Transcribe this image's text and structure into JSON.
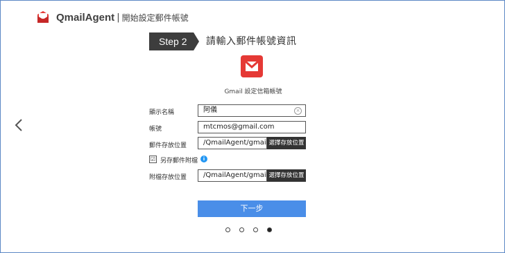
{
  "header": {
    "app_name": "QmailAgent",
    "separator": "|",
    "subtitle": "開始設定郵件帳號"
  },
  "step": {
    "label": "Step 2",
    "title": "請輸入郵件帳號資訊"
  },
  "provider": {
    "caption": "Gmail 設定信箱帳號",
    "brand_color": "#e53935"
  },
  "form": {
    "display_name": {
      "label": "顯示名稱",
      "value": "阿儀"
    },
    "account": {
      "label": "帳號",
      "value": "mtcmos@gmail.com"
    },
    "mail_location": {
      "label": "郵件存放位置",
      "value": "/QmailAgent/gmail",
      "button": "選擇存放位置"
    },
    "save_attachments": {
      "label": "另存郵件附檔",
      "checked": true,
      "check_glyph": "☑"
    },
    "attachment_location": {
      "label": "附檔存放位置",
      "value": "/QmailAgent/gmail",
      "button": "選擇存放位置"
    }
  },
  "next_button": {
    "label": "下一步",
    "color": "#4a8ee8"
  },
  "pagination": {
    "total": 4,
    "current": 4
  },
  "icons": {
    "clear": "clear-icon",
    "info": "info-icon",
    "prev": "chevron-left-icon",
    "info_glyph": "i",
    "clear_glyph": "×"
  }
}
